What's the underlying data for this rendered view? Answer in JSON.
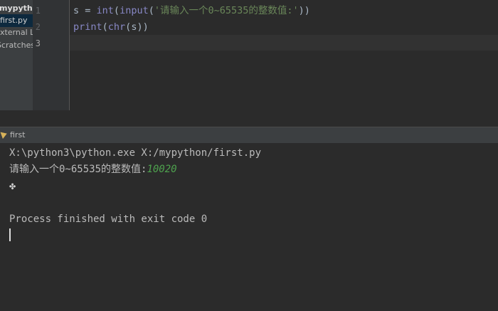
{
  "project": {
    "root_label": "mypython",
    "file_label": "first.py",
    "external_label": "External Libraries",
    "scratches_label": "Scratches and Consoles"
  },
  "editor": {
    "line_numbers": [
      "1",
      "2",
      "3"
    ],
    "lines": [
      {
        "var": "s",
        "op": " = ",
        "fn1": "int",
        "p1": "(",
        "fn2": "input",
        "p2": "(",
        "str": "'请输入一个0~65535的整数值:'",
        "close": "))"
      },
      {
        "fn1": "print",
        "p1": "(",
        "fn2": "chr",
        "p2": "(",
        "arg": "s",
        "close": "))"
      }
    ]
  },
  "run": {
    "tab_label": "first",
    "command": "X:\\python3\\python.exe X:/mypython/first.py",
    "prompt": "请输入一个0~65535的整数值:",
    "user_input": "10020",
    "output_char": "✤",
    "exit_message": "Process finished with exit code 0"
  },
  "colors": {
    "editor_bg": "#2b2b2b",
    "sidebar_bg": "#3c3f41",
    "builtin": "#8888c6",
    "string": "#6a8759",
    "user_input": "#4ea24e"
  }
}
